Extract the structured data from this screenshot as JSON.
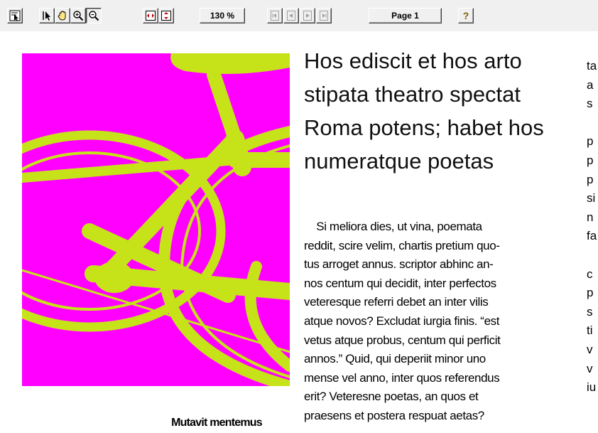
{
  "toolbar": {
    "zoom_label": "130 %",
    "page_label": "Page 1",
    "help_label": "?",
    "icons": [
      "select-text-icon",
      "pointer-icon",
      "hand-pan-icon",
      "zoom-in-icon",
      "zoom-out-icon",
      "fit-width-icon",
      "fit-height-icon",
      "first-page-icon",
      "previous-page-icon",
      "next-page-icon",
      "last-page-icon"
    ]
  },
  "colors": {
    "background": "#ff00ff",
    "bicycle": "#c6e31a",
    "toolbar": "#f0f0f0"
  },
  "document": {
    "caption": "Mutavit mentemus",
    "headline_lines": [
      "Hos ediscit et hos arto",
      "stipata theatro spectat",
      "Roma potens; habet hos",
      "numeratque poetas"
    ],
    "body_lines": [
      "    Si meliora dies, ut vina, poemata",
      "reddit, scire velim, chartis pretium quo-",
      "tus arroget annus. scriptor abhinc an-",
      "nos centum qui decidit, inter perfectos",
      "veteresque referri debet an inter vilis",
      "atque novos? Excludat iurgia finis. “est",
      "vetus atque probus, centum qui perficit",
      "annos.” Quid, qui deperiit minor uno",
      "mense vel anno, inter quos referendus",
      "erit? Veteresne poetas, an quos et",
      "praesens et postera respuat aetas?"
    ],
    "col3_lines": [
      "ta",
      "a",
      "s",
      "",
      "p",
      "p",
      "p",
      "si",
      "n",
      "fa",
      "",
      "c",
      "p",
      "s",
      "ti",
      "v",
      "v",
      "iu"
    ]
  }
}
